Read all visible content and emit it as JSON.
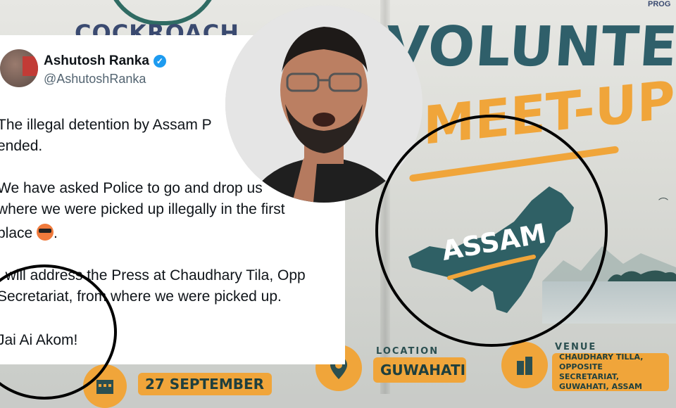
{
  "banner": {
    "org_text": "COCKROACH",
    "prog_text": "PROG",
    "headline_line1": "VOLUNTEER",
    "headline_line2": "MEET-UP",
    "map_label": "ASSAM",
    "location_label": "LOCATION",
    "location_value": "GUWAHATI",
    "date_value": "27 SEPTEMBER",
    "venue_label": "VENUE",
    "venue_line1": "CHAUDHARY TILLA,",
    "venue_line2": "OPPOSITE SECRETARIAT,",
    "venue_line3": "GUWAHATI, ASSAM",
    "colors": {
      "teal": "#2f5f6a",
      "orange": "#f0a53a"
    }
  },
  "tweet": {
    "author_name": "Ashutosh Ranka",
    "author_handle": "@AshutoshRanka",
    "verified_icon": "verified-badge-icon",
    "lines": [
      "The illegal detention by Assam P",
      "ended.",
      "We have asked Police to go and drop us",
      "where we were picked up illegally in the first",
      "place",
      ".",
      "I will address the Press at Chaudhary Tila, Opp",
      "Secretariat, from where we were picked up.",
      "Jai Ai Akom!"
    ],
    "emoji": "sunglasses-emoji"
  }
}
